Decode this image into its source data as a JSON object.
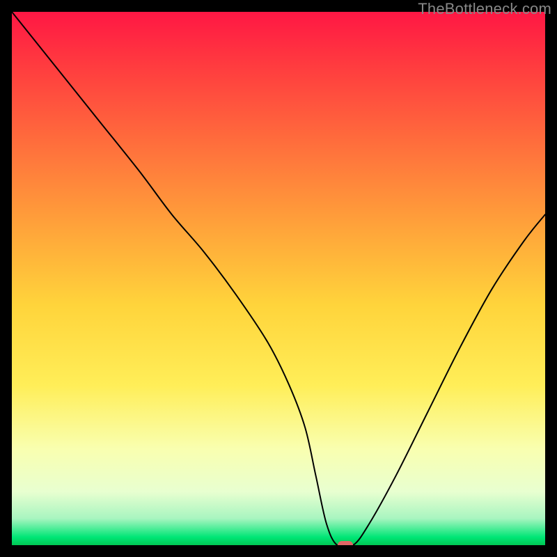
{
  "watermark_text": "TheBottleneck.com",
  "marker_color": "#e06666",
  "chart_data": {
    "type": "line",
    "title": "",
    "xlabel": "",
    "ylabel": "",
    "x_range": [
      0,
      100
    ],
    "y_range": [
      0,
      100
    ],
    "series": [
      {
        "name": "bottleneck-curve",
        "x": [
          0,
          8,
          16,
          24,
          30,
          36,
          42,
          48,
          52,
          55,
          57,
          59,
          61,
          64,
          67,
          72,
          78,
          84,
          90,
          96,
          100
        ],
        "y": [
          100,
          90,
          80,
          70,
          62,
          55,
          47,
          38,
          30,
          22,
          13,
          4,
          0,
          0,
          4,
          13,
          25,
          37,
          48,
          57,
          62
        ]
      }
    ],
    "minimum_marker": {
      "x": 62.5,
      "y": 0
    },
    "background_gradient_stops": [
      {
        "offset": 0.0,
        "color": "#ff1744"
      },
      {
        "offset": 0.1,
        "color": "#ff3b3f"
      },
      {
        "offset": 0.25,
        "color": "#ff6f3c"
      },
      {
        "offset": 0.4,
        "color": "#ffa23a"
      },
      {
        "offset": 0.55,
        "color": "#ffd43b"
      },
      {
        "offset": 0.7,
        "color": "#ffee58"
      },
      {
        "offset": 0.82,
        "color": "#f9ffb0"
      },
      {
        "offset": 0.9,
        "color": "#e8ffd0"
      },
      {
        "offset": 0.95,
        "color": "#a8f5c0"
      },
      {
        "offset": 0.985,
        "color": "#00e676"
      },
      {
        "offset": 1.0,
        "color": "#00c853"
      }
    ]
  }
}
